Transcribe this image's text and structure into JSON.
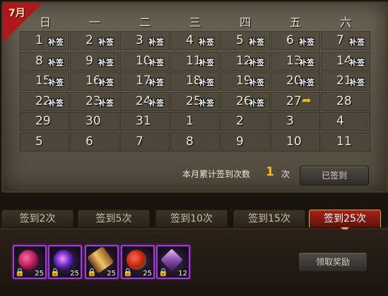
{
  "calendar": {
    "month_label": "7月",
    "weekdays": [
      "日",
      "一",
      "二",
      "三",
      "四",
      "五",
      "六"
    ],
    "makeup_tag": "补签",
    "rows": [
      [
        {
          "d": "1",
          "makeup": true
        },
        {
          "d": "2",
          "makeup": true
        },
        {
          "d": "3",
          "makeup": true
        },
        {
          "d": "4",
          "makeup": true
        },
        {
          "d": "5",
          "makeup": true
        },
        {
          "d": "6",
          "makeup": true
        },
        {
          "d": "7",
          "makeup": true
        }
      ],
      [
        {
          "d": "8",
          "makeup": true
        },
        {
          "d": "9",
          "makeup": true
        },
        {
          "d": "10",
          "makeup": true
        },
        {
          "d": "11",
          "makeup": true
        },
        {
          "d": "12",
          "makeup": true
        },
        {
          "d": "13",
          "makeup": true
        },
        {
          "d": "14",
          "makeup": true
        }
      ],
      [
        {
          "d": "15",
          "makeup": true
        },
        {
          "d": "16",
          "makeup": true
        },
        {
          "d": "17",
          "makeup": true
        },
        {
          "d": "18",
          "makeup": true
        },
        {
          "d": "19",
          "makeup": true
        },
        {
          "d": "20",
          "makeup": true
        },
        {
          "d": "21",
          "makeup": true
        }
      ],
      [
        {
          "d": "22",
          "makeup": true
        },
        {
          "d": "23",
          "makeup": true
        },
        {
          "d": "24",
          "makeup": true
        },
        {
          "d": "25",
          "makeup": true
        },
        {
          "d": "26",
          "makeup": true
        },
        {
          "d": "27",
          "today": true
        },
        {
          "d": "28"
        }
      ],
      [
        {
          "d": "29"
        },
        {
          "d": "30"
        },
        {
          "d": "31"
        },
        {
          "d": "1"
        },
        {
          "d": "2"
        },
        {
          "d": "3"
        },
        {
          "d": "4"
        }
      ],
      [
        {
          "d": "5"
        },
        {
          "d": "6"
        },
        {
          "d": "7"
        },
        {
          "d": "8"
        },
        {
          "d": "9"
        },
        {
          "d": "10"
        },
        {
          "d": "11"
        }
      ]
    ],
    "today_marker_icon": "today-arrow-icon"
  },
  "summary": {
    "label": "本月累计签到次数",
    "count": "1",
    "unit": "次",
    "signed_button": "已签到"
  },
  "tabs": [
    {
      "label": "签到2次",
      "active": false
    },
    {
      "label": "签到5次",
      "active": false
    },
    {
      "label": "签到10次",
      "active": false
    },
    {
      "label": "签到15次",
      "active": false
    },
    {
      "label": "签到25次",
      "active": true
    }
  ],
  "rewards": {
    "items": [
      {
        "icon": "red-gem-flower-icon",
        "count": "25",
        "locked": true
      },
      {
        "icon": "purple-orb-icon",
        "count": "25",
        "locked": true
      },
      {
        "icon": "golden-scroll-icon",
        "count": "25",
        "locked": true
      },
      {
        "icon": "red-fruit-icon",
        "count": "25",
        "locked": true
      },
      {
        "icon": "purple-crystal-icon",
        "count": "12",
        "locked": true
      }
    ],
    "claim_button": "领取奖励"
  },
  "colors": {
    "accent_red": "#b0171a",
    "count_orange": "#ffb32a",
    "item_border_purple": "#a13bd6"
  }
}
